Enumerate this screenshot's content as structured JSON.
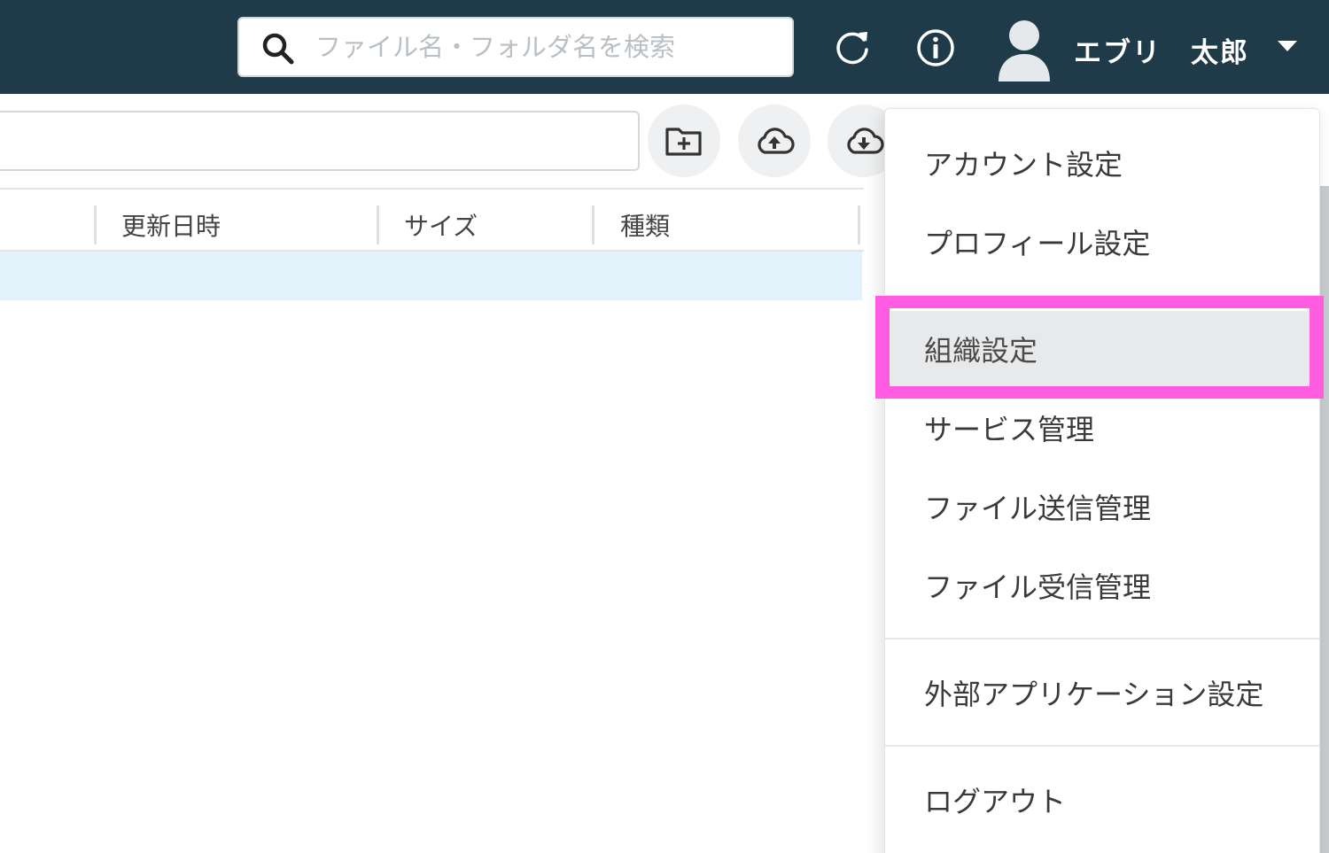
{
  "header": {
    "search": {
      "placeholder": "ファイル名・フォルダ名を検索",
      "value": ""
    },
    "user": {
      "name": "エブリ　太郎"
    }
  },
  "table": {
    "columns": [
      "更新日時",
      "サイズ",
      "種類"
    ]
  },
  "dropdown": {
    "items": [
      "アカウント設定",
      "プロフィール設定",
      "組織設定",
      "サービス管理",
      "ファイル送信管理",
      "ファイル受信管理",
      "外部アプリケーション設定",
      "ログアウト"
    ],
    "highlighted_item": "組織設定"
  },
  "colors": {
    "header_bg": "#1f3a48",
    "highlight_border": "#ff5ce1",
    "selected_row": "#e3f1fb",
    "active_item_bg": "#e8e9ea"
  }
}
